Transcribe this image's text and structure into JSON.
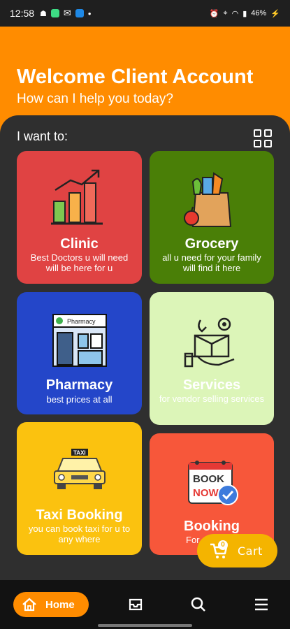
{
  "status_bar": {
    "time": "12:58",
    "battery": "46%",
    "colors": {
      "app1": "#3ddc84",
      "app2": "#1e88e5"
    }
  },
  "header": {
    "title": "Welcome Client Account",
    "subtitle": "How can I help you today?",
    "bg_color": "#ff8c00"
  },
  "main": {
    "prompt": "I want to:",
    "grid_toggle_icon": "grid-icon",
    "cards": [
      {
        "title": "Clinic",
        "desc": "Best Doctors u will need will be here for u",
        "color": "#e04343",
        "icon": "bar-chart-icon"
      },
      {
        "title": "Grocery",
        "desc": "all u need for your family will find it here",
        "color": "#4a7f07",
        "icon": "grocery-bag-icon"
      },
      {
        "title": "Pharmacy",
        "desc": "best prices at all",
        "color": "#2446c9",
        "icon": "pharmacy-store-icon",
        "sign": "Pharmacy"
      },
      {
        "title": "Services",
        "desc": "for vendor selling services",
        "color": "#dcf5b8",
        "icon": "service-box-icon"
      },
      {
        "title": "Taxi Booking",
        "desc": "you can book taxi for u to any where",
        "color": "#fbc20f",
        "icon": "taxi-icon",
        "sign": "TAXI"
      },
      {
        "title": "Booking",
        "desc": "For …",
        "color": "#f7573a",
        "icon": "calendar-book-now-icon",
        "sign1": "BOOK",
        "sign2": "NOW"
      }
    ]
  },
  "cart": {
    "label": "Cart",
    "count": "0",
    "color": "#f4b400"
  },
  "bottom_nav": {
    "home_label": "Home",
    "items": [
      "home-icon",
      "inbox-icon",
      "search-icon",
      "menu-icon"
    ]
  }
}
